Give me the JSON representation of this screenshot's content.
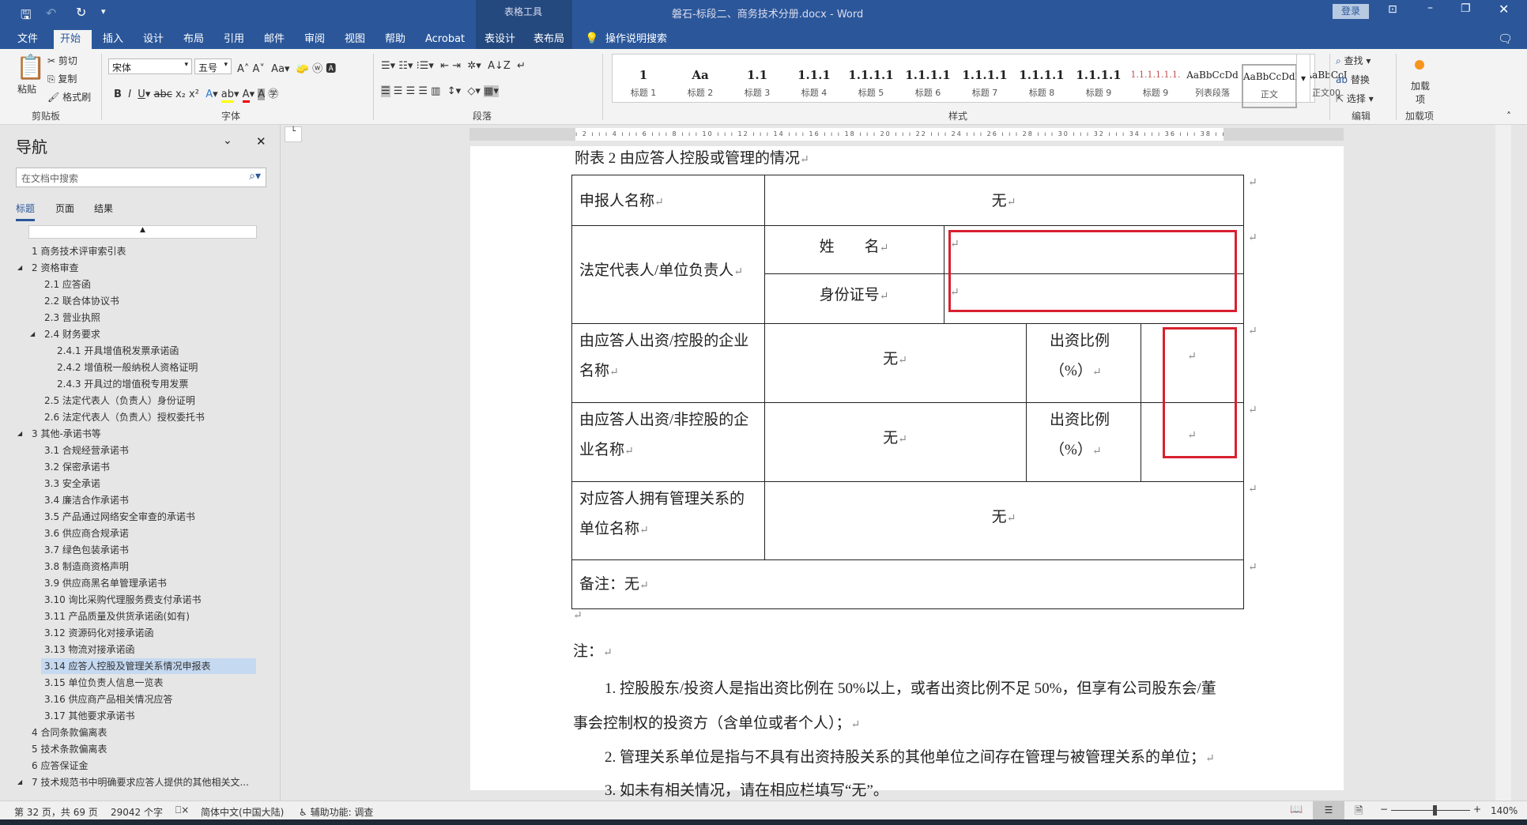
{
  "title_bar": {
    "doc_title": "磐石-标段二、商务技术分册.docx  -  Word",
    "context_tab": "表格工具",
    "signin": "登录"
  },
  "tabs": [
    "文件",
    "开始",
    "插入",
    "设计",
    "布局",
    "引用",
    "邮件",
    "审阅",
    "视图",
    "帮助",
    "Acrobat",
    "表设计",
    "表布局"
  ],
  "tell_me": "操作说明搜索",
  "ribbon": {
    "clipboard": {
      "paste": "粘贴",
      "cut": "剪切",
      "copy": "复制",
      "format_painter": "格式刷",
      "label": "剪贴板"
    },
    "font": {
      "name": "宋体",
      "size": "五号",
      "label": "字体"
    },
    "paragraph": {
      "label": "段落"
    },
    "styles": {
      "label": "样式",
      "items": [
        {
          "pv": "1",
          "nm": "标题 1"
        },
        {
          "pv": "Aa",
          "nm": "标题 2"
        },
        {
          "pv": "1.1",
          "nm": "标题 3"
        },
        {
          "pv": "1.1.1",
          "nm": "标题 4"
        },
        {
          "pv": "1.1.1.1",
          "nm": "标题 5"
        },
        {
          "pv": "1.1.1.1",
          "nm": "标题 6"
        },
        {
          "pv": "1.1.1.1",
          "nm": "标题 7"
        },
        {
          "pv": "1.1.1.1",
          "nm": "标题 8"
        },
        {
          "pv": "1.1.1.1",
          "nm": "标题 9"
        },
        {
          "pv": "1.1.1.1.1.1.",
          "nm": "标题 9"
        },
        {
          "pv": "AaBbCcDd",
          "nm": "列表段落"
        },
        {
          "pv": "AaBbCcDdI",
          "nm": "正文"
        },
        {
          "pv": "AaBbCcI",
          "nm": "正文00"
        }
      ]
    },
    "editing": {
      "find": "查找",
      "replace": "替换",
      "select": "选择",
      "label": "编辑"
    },
    "addins": {
      "button": "加载项",
      "label": "加载项"
    }
  },
  "nav": {
    "title": "导航",
    "search_placeholder": "在文档中搜索",
    "tabs": [
      "标题",
      "页面",
      "结果"
    ],
    "items": [
      {
        "t": "1 商务技术评审索引表",
        "l": 1
      },
      {
        "t": "2 资格审查",
        "l": 1,
        "exp": true
      },
      {
        "t": "2.1 应答函",
        "l": 2
      },
      {
        "t": "2.2 联合体协议书",
        "l": 2
      },
      {
        "t": "2.3 营业执照",
        "l": 2
      },
      {
        "t": "2.4 财务要求",
        "l": 2,
        "exp": true
      },
      {
        "t": "2.4.1 开具增值税发票承诺函",
        "l": 3
      },
      {
        "t": "2.4.2 增值税一般纳税人资格证明",
        "l": 3
      },
      {
        "t": "2.4.3 开具过的增值税专用发票",
        "l": 3
      },
      {
        "t": "2.5 法定代表人（负责人）身份证明",
        "l": 2
      },
      {
        "t": "2.6 法定代表人（负责人）授权委托书",
        "l": 2
      },
      {
        "t": "3 其他-承诺书等",
        "l": 1,
        "exp": true
      },
      {
        "t": "3.1 合规经营承诺书",
        "l": 2
      },
      {
        "t": "3.2 保密承诺书",
        "l": 2
      },
      {
        "t": "3.3 安全承诺",
        "l": 2
      },
      {
        "t": "3.4 廉洁合作承诺书",
        "l": 2
      },
      {
        "t": "3.5 产品通过网络安全审查的承诺书",
        "l": 2
      },
      {
        "t": "3.6 供应商合规承诺",
        "l": 2
      },
      {
        "t": "3.7 绿色包装承诺书",
        "l": 2
      },
      {
        "t": "3.8 制造商资格声明",
        "l": 2
      },
      {
        "t": "3.9 供应商黑名单管理承诺书",
        "l": 2
      },
      {
        "t": "3.10 询比采购代理服务费支付承诺书",
        "l": 2
      },
      {
        "t": "3.11 产品质量及供货承诺函(如有)",
        "l": 2
      },
      {
        "t": "3.12 资源码化对接承诺函",
        "l": 2
      },
      {
        "t": "3.13 物流对接承诺函",
        "l": 2
      },
      {
        "t": "3.14 应答人控股及管理关系情况申报表",
        "l": 2,
        "sel": true
      },
      {
        "t": "3.15 单位负责人信息一览表",
        "l": 2
      },
      {
        "t": "3.16 供应商产品相关情况应答",
        "l": 2
      },
      {
        "t": "3.17 其他要求承诺书",
        "l": 2
      },
      {
        "t": "4 合同条款偏离表",
        "l": 1
      },
      {
        "t": "5 技术条款偏离表",
        "l": 1
      },
      {
        "t": "6 应答保证金",
        "l": 1
      },
      {
        "t": "7 技术规范书中明确要求应答人提供的其他相关文...",
        "l": 1,
        "exp": true
      }
    ]
  },
  "doc": {
    "caption": "附表 2 由应答人控股或管理的情况",
    "table": {
      "applicant_label": "申报人名称",
      "applicant_value": "无",
      "legal_rep_label": "法定代表人/单位负责人",
      "name_label": "姓　　名",
      "id_label": "身份证号",
      "name_value": "",
      "id_value": "",
      "controlled_label": "由应答人出资/控股的企业名称",
      "controlled_value": "无",
      "ratio_label": "出资比例（%）",
      "controlled_ratio": "",
      "noncontrolled_label": "由应答人出资/非控股的企业名称",
      "noncontrolled_value": "无",
      "noncontrolled_ratio": "",
      "managed_label": "对应答人拥有管理关系的单位名称",
      "managed_value": "无",
      "remark": "备注：无"
    },
    "note_title": "注：",
    "notes": [
      "1. 控股股东/投资人是指出资比例在 50%以上，或者出资比例不足 50%，但享有公司股东会/董",
      "事会控制权的投资方（含单位或者个人）；",
      "2. 管理关系单位是指与不具有出资持股关系的其他单位之间存在管理与被管理关系的单位；",
      "3. 如未有相关情况，请在相应栏填写“无”。"
    ]
  },
  "status": {
    "page": "第 32 页，共 69 页",
    "words": "29042 个字",
    "language": "简体中文(中国大陆)",
    "accessibility": "辅助功能: 调查",
    "zoom": "140%",
    "zoom_fraction": 0.55
  },
  "colors": {
    "brand": "#2b579a",
    "highlight": "#d9202f"
  }
}
